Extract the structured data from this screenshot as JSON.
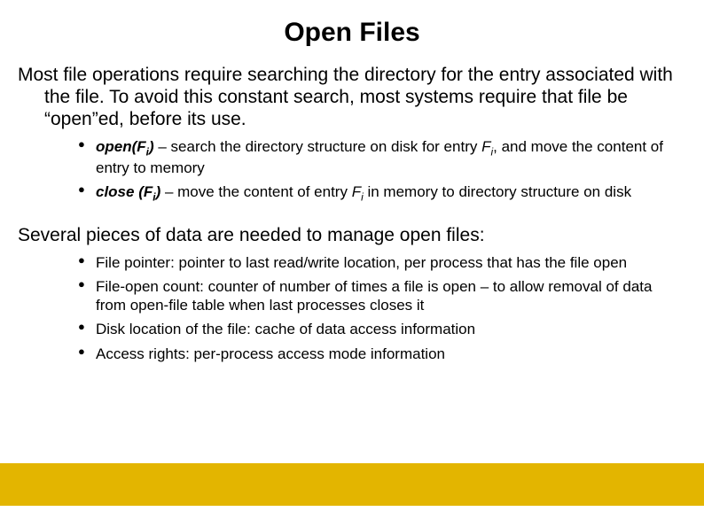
{
  "title": "Open Files",
  "para1_prefix": "Most file operations require searching the directory for the entry associated with the file. To avoid this constant search, most systems require that file be “open”ed, before its use.",
  "op_bullets": {
    "open_label": "open(F",
    "open_sub": "i",
    "open_label2": ")",
    "open_rest_a": " – search the directory structure on disk for entry ",
    "open_f": "F",
    "open_fsub": "i",
    "open_rest_b": ", and move the content of entry to memory",
    "close_label": "close (F",
    "close_sub": "i",
    "close_label2": ")",
    "close_rest_a": " – move the content of entry ",
    "close_f": "F",
    "close_fsub": "i",
    "close_rest_b": " in memory to directory structure on disk"
  },
  "para2": "Several pieces of data are needed to manage open files:",
  "data_bullets": {
    "b1": "File pointer:  pointer to last read/write location, per process that has the file open",
    "b2": "File-open count: counter of number of times a file is open – to allow removal of data from open-file table when last processes closes it",
    "b3": "Disk location of the file: cache of data access information",
    "b4": "Access rights: per-process access mode information"
  }
}
